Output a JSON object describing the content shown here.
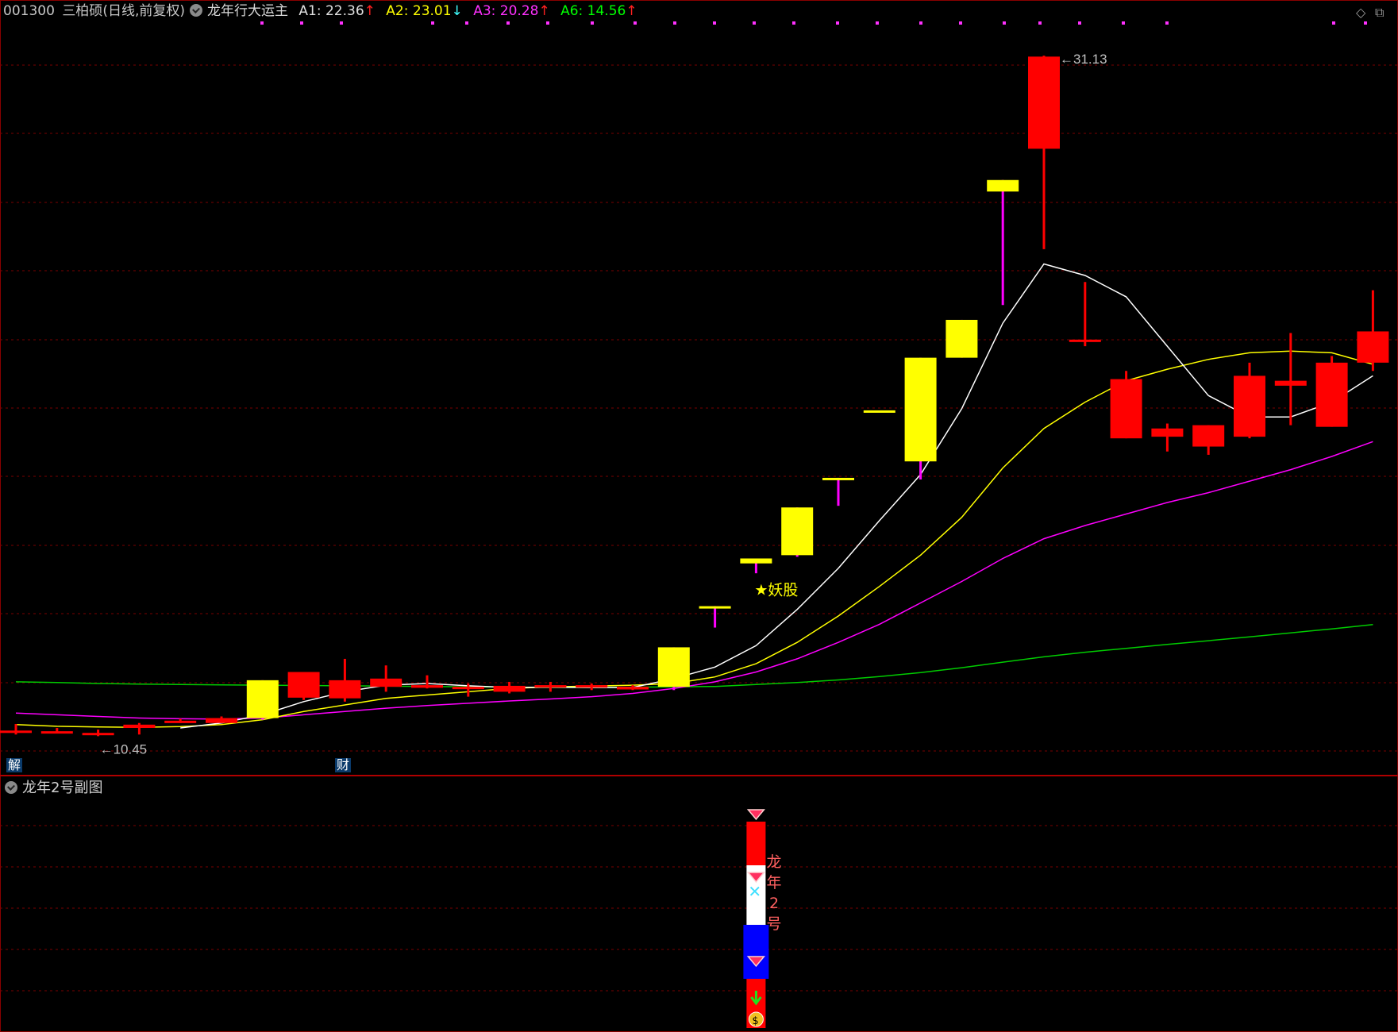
{
  "header": {
    "code": "001300",
    "name": "三柏硕",
    "period": "(日线,前复权)",
    "indicator": "龙年行大运主",
    "A1": {
      "label": "A1: 22.36",
      "arrow": "↑",
      "color": "#e0e0e0",
      "arrow_color": "#ff2020"
    },
    "A2": {
      "label": "A2: 23.01",
      "arrow": "↓",
      "color": "#ffff00",
      "arrow_color": "#40ffff"
    },
    "A3": {
      "label": "A3: 20.28",
      "arrow": "↑",
      "color": "#ff30ff",
      "arrow_color": "#ff2020"
    },
    "A6": {
      "label": "A6: 14.56",
      "arrow": "↑",
      "color": "#00ff00",
      "arrow_color": "#ff2020"
    }
  },
  "sub_panel": {
    "title": "龙年2号副图",
    "vertical_label": [
      "龙",
      "年",
      "2",
      "号"
    ]
  },
  "badges": {
    "jie": "解",
    "cai": "财"
  },
  "icons": {
    "diamond": "diamond-icon",
    "window": "window-icon",
    "settings": "gear-icon"
  },
  "chart_data": {
    "type": "candlestick",
    "ylim": [
      10.0,
      32.0
    ],
    "high_label": "31.13",
    "low_label": "10.45",
    "annotation": "★妖股",
    "colors": {
      "up": "#ffff00",
      "down": "#ff0000",
      "ma5": "#ffffff",
      "ma10": "#ffff00",
      "ma20": "#ff00ff",
      "ma60": "#00cc00",
      "grid": "#7a0000"
    },
    "candles": [
      {
        "o": 10.62,
        "h": 10.82,
        "l": 10.5,
        "c": 10.58,
        "col": "down"
      },
      {
        "o": 10.6,
        "h": 10.7,
        "l": 10.55,
        "c": 10.58,
        "col": "down"
      },
      {
        "o": 10.55,
        "h": 10.65,
        "l": 10.45,
        "c": 10.52,
        "col": "down"
      },
      {
        "o": 10.8,
        "h": 10.85,
        "l": 10.5,
        "c": 10.7,
        "col": "down"
      },
      {
        "o": 10.92,
        "h": 10.98,
        "l": 10.85,
        "c": 10.85,
        "col": "down"
      },
      {
        "o": 11.0,
        "h": 11.05,
        "l": 10.85,
        "c": 10.85,
        "col": "down"
      },
      {
        "o": 11.0,
        "h": 12.15,
        "l": 10.95,
        "c": 12.15,
        "col": "up"
      },
      {
        "o": 12.4,
        "h": 12.4,
        "l": 11.55,
        "c": 11.62,
        "col": "down"
      },
      {
        "o": 12.15,
        "h": 12.8,
        "l": 11.5,
        "c": 11.6,
        "col": "down"
      },
      {
        "o": 12.2,
        "h": 12.6,
        "l": 11.8,
        "c": 11.95,
        "col": "down"
      },
      {
        "o": 12.0,
        "h": 12.3,
        "l": 11.9,
        "c": 11.92,
        "col": "down"
      },
      {
        "o": 11.95,
        "h": 12.05,
        "l": 11.65,
        "c": 11.92,
        "col": "down"
      },
      {
        "o": 11.98,
        "h": 12.1,
        "l": 11.75,
        "c": 11.8,
        "col": "down"
      },
      {
        "o": 12.0,
        "h": 12.1,
        "l": 11.8,
        "c": 11.95,
        "col": "down"
      },
      {
        "o": 12.0,
        "h": 12.05,
        "l": 11.85,
        "c": 11.95,
        "col": "down"
      },
      {
        "o": 11.95,
        "h": 12.0,
        "l": 11.85,
        "c": 11.87,
        "col": "down"
      },
      {
        "o": 11.95,
        "h": 13.15,
        "l": 11.85,
        "c": 13.15,
        "col": "up"
      },
      {
        "o": 14.4,
        "h": 14.4,
        "l": 13.75,
        "c": 14.4,
        "col": "up"
      },
      {
        "o": 15.7,
        "h": 15.85,
        "l": 15.4,
        "c": 15.85,
        "col": "up"
      },
      {
        "o": 15.95,
        "h": 17.4,
        "l": 15.9,
        "c": 17.4,
        "col": "up"
      },
      {
        "o": 18.3,
        "h": 18.3,
        "l": 17.45,
        "c": 18.3,
        "col": "up"
      },
      {
        "o": 20.35,
        "h": 20.35,
        "l": 20.35,
        "c": 20.35,
        "col": "up"
      },
      {
        "o": 18.8,
        "h": 21.95,
        "l": 18.25,
        "c": 21.95,
        "col": "up"
      },
      {
        "o": 21.95,
        "h": 23.1,
        "l": 21.95,
        "c": 23.1,
        "col": "up"
      },
      {
        "o": 27.0,
        "h": 27.35,
        "l": 23.55,
        "c": 27.35,
        "col": "up"
      },
      {
        "o": 31.1,
        "h": 31.13,
        "l": 25.25,
        "c": 28.3,
        "col": "down"
      },
      {
        "o": 22.5,
        "h": 24.25,
        "l": 22.3,
        "c": 22.5,
        "col": "down"
      },
      {
        "o": 21.3,
        "h": 21.55,
        "l": 19.5,
        "c": 19.5,
        "col": "down"
      },
      {
        "o": 19.8,
        "h": 19.95,
        "l": 19.1,
        "c": 19.55,
        "col": "down"
      },
      {
        "o": 19.9,
        "h": 19.9,
        "l": 19.0,
        "c": 19.25,
        "col": "down"
      },
      {
        "o": 21.4,
        "h": 21.8,
        "l": 19.5,
        "c": 19.55,
        "col": "down"
      },
      {
        "o": 21.25,
        "h": 22.7,
        "l": 19.9,
        "c": 21.1,
        "col": "down"
      },
      {
        "o": 21.8,
        "h": 22.0,
        "l": 19.85,
        "c": 19.85,
        "col": "down"
      },
      {
        "o": 22.75,
        "h": 24.0,
        "l": 21.55,
        "c": 21.8,
        "col": "down"
      }
    ],
    "ma5": [
      null,
      null,
      null,
      null,
      10.7,
      10.85,
      11.1,
      11.5,
      11.8,
      12.0,
      12.05,
      11.98,
      11.93,
      11.94,
      11.93,
      11.93,
      12.2,
      12.55,
      13.2,
      14.3,
      15.55,
      17.0,
      18.4,
      20.4,
      23.0,
      24.8,
      24.45,
      23.8,
      22.3,
      20.8,
      20.15,
      20.15,
      20.6,
      21.4
    ],
    "ma10": [
      10.8,
      10.75,
      10.73,
      10.72,
      10.74,
      10.8,
      10.95,
      11.2,
      11.4,
      11.6,
      11.7,
      11.8,
      11.9,
      11.95,
      11.97,
      12.0,
      12.05,
      12.25,
      12.65,
      13.3,
      14.1,
      15.0,
      15.95,
      17.1,
      18.6,
      19.8,
      20.6,
      21.25,
      21.6,
      21.9,
      22.1,
      22.15,
      22.1,
      21.75
    ],
    "ma20": [
      11.15,
      11.1,
      11.05,
      11.0,
      10.98,
      10.97,
      11.0,
      11.1,
      11.2,
      11.3,
      11.38,
      11.45,
      11.52,
      11.58,
      11.65,
      11.75,
      11.9,
      12.1,
      12.4,
      12.8,
      13.3,
      13.85,
      14.5,
      15.15,
      15.85,
      16.45,
      16.85,
      17.2,
      17.55,
      17.85,
      18.2,
      18.55,
      18.95,
      19.4
    ],
    "ma60": [
      12.1,
      12.08,
      12.05,
      12.03,
      12.02,
      12.01,
      12.0,
      11.99,
      11.98,
      11.97,
      11.96,
      11.95,
      11.94,
      11.93,
      11.93,
      11.94,
      11.95,
      11.96,
      12.02,
      12.08,
      12.16,
      12.26,
      12.38,
      12.53,
      12.7,
      12.86,
      13.0,
      13.12,
      13.24,
      13.35,
      13.47,
      13.59,
      13.71,
      13.84
    ],
    "sub_panel": {
      "type": "bar",
      "stack": [
        "red",
        "white",
        "blue",
        "red"
      ]
    }
  }
}
